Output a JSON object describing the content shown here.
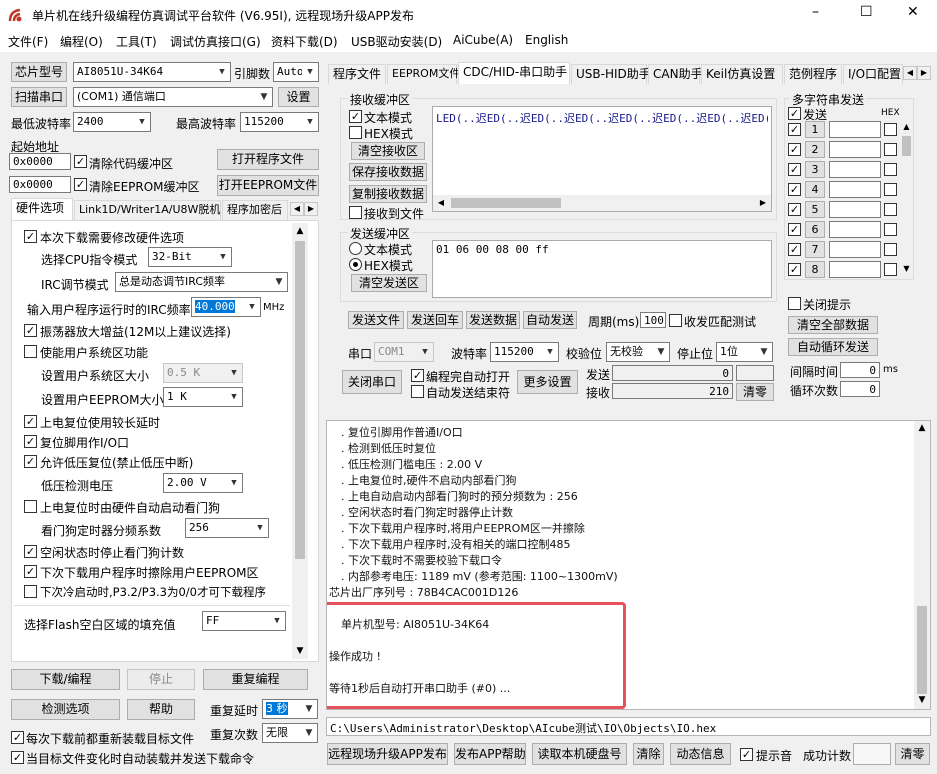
{
  "window": {
    "title": "单片机在线升级编程仿真调试平台软件 (V6.95I), 远程现场升级APP发布",
    "minimize": "–",
    "maximize": "☐",
    "close": "✕"
  },
  "menu": [
    "文件(F)",
    "编程(O)",
    "工具(T)",
    "调试仿真接口(G)",
    "资料下载(D)",
    "USB驱动安装(D)",
    "AiCube(A)",
    "English"
  ],
  "left": {
    "chip_label": "芯片型号",
    "chip_value": "AI8051U-34K64",
    "pin_label": "引脚数",
    "pin_value": "Auto",
    "scan_button": "扫描串口",
    "port_value": "(COM1) 通信端口",
    "settings_button": "设置",
    "min_baud_label": "最低波特率",
    "min_baud_value": "2400",
    "max_baud_label": "最高波特率",
    "max_baud_value": "115200",
    "start_addr_label": "起始地址",
    "addr1": "0x0000",
    "clear_code": "清除代码缓冲区",
    "open_prog": "打开程序文件",
    "addr2": "0x0000",
    "clear_eeprom": "清除EEPROM缓冲区",
    "open_eeprom": "打开EEPROM文件",
    "tabs": [
      "硬件选项",
      "Link1D/Writer1A/U8W脱机",
      "程序加密后"
    ],
    "opt_modify_hw": "本次下载需要修改硬件选项",
    "cpu_mode_label": "选择CPU指令模式",
    "cpu_mode_value": "32-Bit",
    "irc_mode_label": "IRC调节模式",
    "irc_mode_value": "总是动态调节IRC频率",
    "irc_freq_label": "输入用户程序运行时的IRC频率",
    "irc_freq_value": "40.000",
    "irc_unit": "MHz",
    "opt_osc": "振荡器放大增益(12M以上建议选择)",
    "opt_sys_area": "使能用户系统区功能",
    "sys_area_size_label": "设置用户系统区大小",
    "sys_area_size_value": "0.5 K",
    "eeprom_size_label": "设置用户EEPROM大小",
    "eeprom_size_value": "1  K",
    "opt_power_delay": "上电复位使用较长延时",
    "opt_reset_io": "复位脚用作I/O口",
    "opt_lvr": "允许低压复位(禁止低压中断)",
    "lvd_label": "低压检测电压",
    "lvd_value": "2.00 V",
    "opt_wdt": "上电复位时由硬件自动启动看门狗",
    "wdt_div_label": "看门狗定时器分频系数",
    "wdt_div_value": "256",
    "opt_idle_wdt": "空闲状态时停止看门狗计数",
    "opt_erase_eeprom": "下次下载用户程序时擦除用户EEPROM区",
    "opt_cold_boot": "下次冷启动时,P3.2/P3.3为0/0才可下载程序",
    "flash_fill_label": "选择Flash空白区域的填充值",
    "flash_fill_value": "FF",
    "download_button": "下载/编程",
    "stop_button": "停止",
    "reprog_button": "重复编程",
    "check_button": "检测选项",
    "help_button": "帮助",
    "repeat_delay_label": "重复延时",
    "repeat_delay_value": "3 秒",
    "repeat_count_label": "重复次数",
    "repeat_count_value": "无限",
    "reload_each": "每次下载前都重新装载目标文件",
    "auto_send": "当目标文件变化时自动装载并发送下载命令"
  },
  "right": {
    "tabs": [
      "程序文件",
      "EEPROM文件",
      "CDC/HID-串口助手",
      "USB-HID助手",
      "CAN助手",
      "Keil仿真设置",
      "范例程序",
      "I/O口配置"
    ],
    "rx_group": "接收缓冲区",
    "rx_text_mode": "文本模式",
    "rx_hex_mode": "HEX模式",
    "rx_clear": "清空接收区",
    "rx_save": "保存接收数据",
    "rx_copy": "复制接收数据",
    "rx_to_file": "接收到文件",
    "rx_content": "LED(..迟ED(..迟ED(..迟ED(..迟ED(..迟ED(..迟ED(..迟ED(..)",
    "tx_group": "发送缓冲区",
    "tx_text_mode": "文本模式",
    "tx_hex_mode": "HEX模式",
    "tx_clear": "清空发送区",
    "tx_content": "01 06 00 08 00 ff",
    "send_file": "发送文件",
    "send_enter": "发送回车",
    "send_data": "发送数据",
    "auto_send": "自动发送",
    "period_label": "周期(ms)",
    "period_value": "100",
    "match_test": "收发匹配测试",
    "port_label": "串口",
    "port_value": "COM1",
    "baud_label": "波特率",
    "baud_value": "115200",
    "parity_label": "校验位",
    "parity_value": "无校验",
    "stop_label": "停止位",
    "stop_value": "1位",
    "close_port": "关闭串口",
    "open_after_prog": "编程完自动打开",
    "auto_send_end": "自动发送结束符",
    "more_settings": "更多设置",
    "send_label": "发送",
    "send_count": "0",
    "recv_label": "接收",
    "recv_count": "210",
    "clear_count": "清零",
    "multi_title": "多字符串发送",
    "multi_send": "发送",
    "multi_hex": "HEX",
    "multi_rows": [
      "1",
      "2",
      "3",
      "4",
      "5",
      "6",
      "7",
      "8"
    ],
    "close_hint": "关闭提示",
    "clear_all": "清空全部数据",
    "auto_loop": "自动循环发送",
    "interval_label": "间隔时间",
    "interval_value": "0",
    "interval_unit": "ms",
    "loop_count_label": "循环次数",
    "loop_count_value": "0"
  },
  "log": {
    "lines": [
      "复位引脚用作普通I/O口",
      "检测到低压时复位",
      "低压检测门槛电压 : 2.00 V",
      "上电复位时,硬件不启动内部看门狗",
      "上电自动启动内部看门狗时的预分频数为 : 256",
      "空闲状态时看门狗定时器停止计数",
      "下次下载用户程序时,将用户EEPROM区一并擦除",
      "下次下载用户程序时,没有相关的端口控制485",
      "下次下载时不需要校验下载口令",
      "内部参考电压: 1189 mV (参考范围: 1100~1300mV)"
    ],
    "serial": "芯片出厂序列号 : 78B4CAC001D126",
    "model": "单片机型号: AI8051U-34K64",
    "success": "操作成功 !",
    "waiting": "等待1秒后自动打开串口助手 (#0) ..."
  },
  "path": "C:\\Users\\Administrator\\Desktop\\AIcube测试\\IO\\Objects\\IO.hex",
  "bottom": {
    "publish_app": "远程现场升级APP发布",
    "publish_help": "发布APP帮助",
    "read_disk": "读取本机硬盘号",
    "clear": "清除",
    "dynamic": "动态信息",
    "beep": "提示音",
    "success_count": "成功计数",
    "count_value": "",
    "reset_count": "清零"
  },
  "colors": {
    "highlight_box": "#e8505b",
    "selection": "#0078d7",
    "title_icon": "#c0392b"
  }
}
